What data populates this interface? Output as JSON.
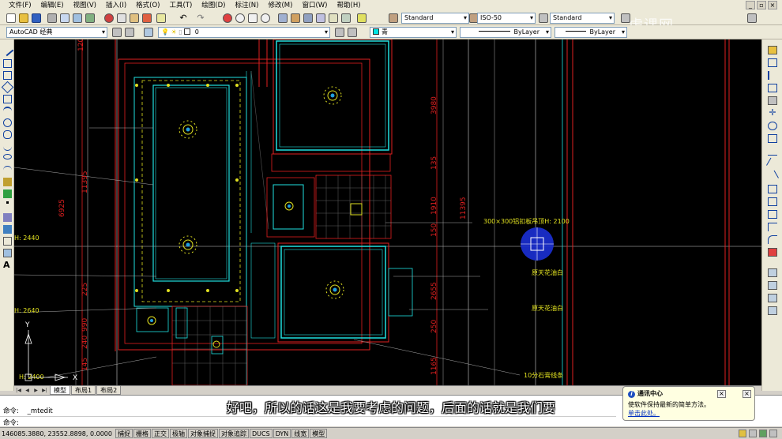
{
  "menu": [
    "文件(F)",
    "编辑(E)",
    "视图(V)",
    "插入(I)",
    "格式(O)",
    "工具(T)",
    "绘图(D)",
    "标注(N)",
    "修改(M)",
    "窗口(W)",
    "帮助(H)"
  ],
  "styles": {
    "text_style": "Standard",
    "dim_style": "ISO-50",
    "table_style": "Standard"
  },
  "workspace": "AutoCAD 经典",
  "layer": "0",
  "color": "青",
  "linetype": "ByLayer",
  "lineweight": "ByLayer",
  "watermark": "虎课网",
  "drawing": {
    "dims": [
      "3980",
      "135",
      "1910",
      "150",
      "2655",
      "250",
      "1165",
      "11395",
      "6925",
      "11395",
      "225",
      "990",
      "240",
      "145",
      "120"
    ],
    "labels": {
      "ceiling_panel": "300×300铝扣板吊顶H: 2100",
      "paint1": "原天花油白",
      "paint2": "原天花油白",
      "gypsum": "10分石膏线条",
      "h2440": "H: 2440",
      "h2640": "H: 2640",
      "h2400": "H: 2400"
    },
    "ucs_y": "Y",
    "ucs_x": "X"
  },
  "tabs": [
    "模型",
    "布局1",
    "布局2"
  ],
  "command": {
    "line1_prompt": "命令:",
    "line1_value": "_mtedit",
    "line2_prompt": "命令:"
  },
  "subtitle": "好吧，所以的话这是我要考虑的问题，后面的话就是我们要",
  "notification": {
    "title": "通讯中心",
    "body": "使软件保持最新的简单方法。",
    "link": "单击此处。"
  },
  "status": {
    "coords": "146085.3880, 23552.8898, 0.0000",
    "buttons": [
      "捕捉",
      "栅格",
      "正交",
      "极轴",
      "对象捕捉",
      "对象追踪",
      "DUCS",
      "DYN",
      "线宽",
      "模型"
    ]
  }
}
